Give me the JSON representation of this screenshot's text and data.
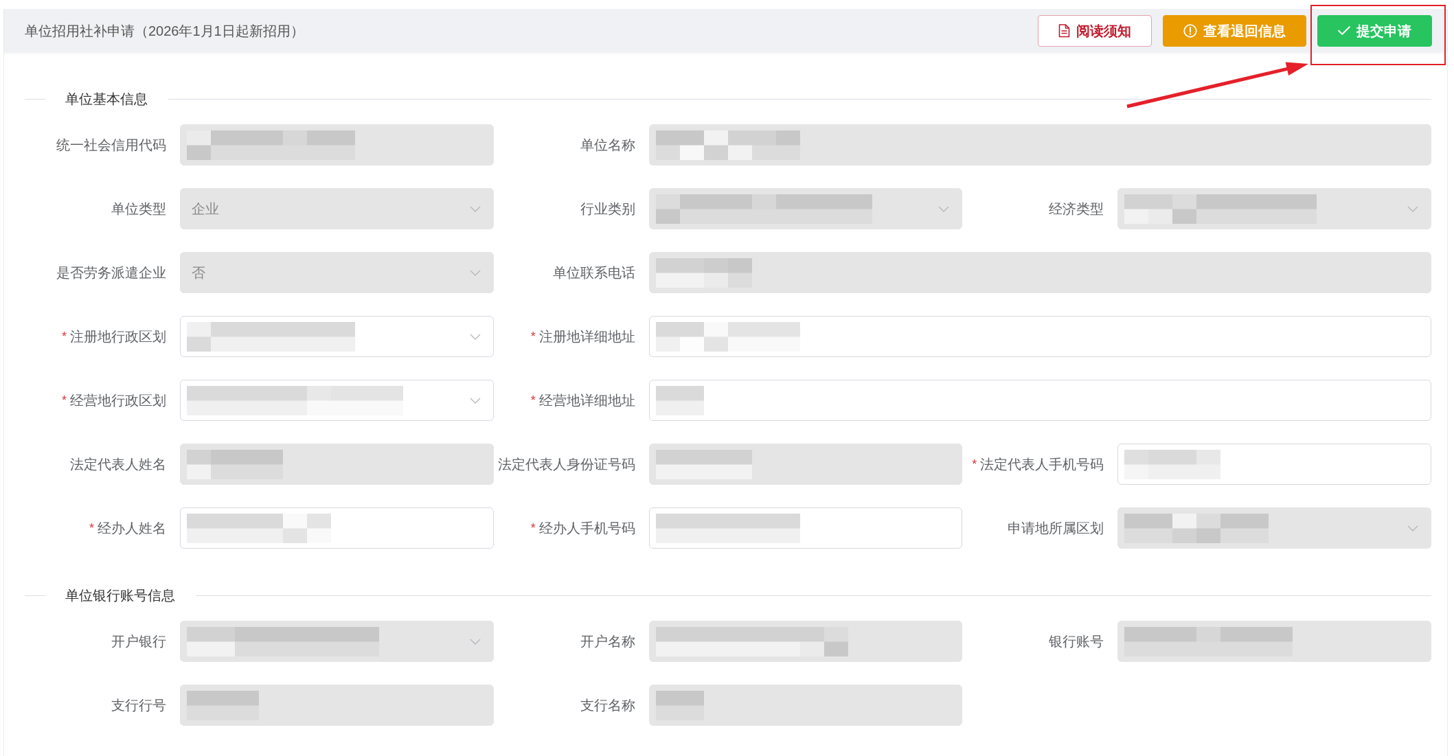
{
  "header": {
    "title": "单位招用社补申请（2026年1月1日起新招用）",
    "buttons": [
      {
        "kind": "notice",
        "label": "阅读须知",
        "highlighted": false
      },
      {
        "kind": "warning",
        "label": "查看退回信息",
        "highlighted": false
      },
      {
        "kind": "submit",
        "label": "提交申请",
        "highlighted": true
      }
    ]
  },
  "sections": [
    {
      "title": "单位基本信息",
      "rows": [
        [
          {
            "label": "统一社会信用代码",
            "kind": "input",
            "disabled": true,
            "redacted": true,
            "wide": false
          },
          {
            "label": "单位名称",
            "kind": "input",
            "disabled": true,
            "redacted": true,
            "wide": true
          }
        ],
        [
          {
            "label": "单位类型",
            "kind": "select",
            "disabled": true,
            "redacted": false,
            "value": "企业",
            "wide": false
          },
          {
            "label": "行业类别",
            "kind": "select",
            "disabled": true,
            "redacted": true,
            "wide": false
          },
          {
            "label": "经济类型",
            "kind": "select",
            "disabled": true,
            "redacted": true,
            "wide": false
          }
        ],
        [
          {
            "label": "是否劳务派遣企业",
            "kind": "select",
            "disabled": true,
            "redacted": false,
            "value": "否",
            "wide": false
          },
          {
            "label": "单位联系电话",
            "kind": "input",
            "disabled": true,
            "redacted": true,
            "wide": true
          }
        ],
        [
          {
            "label": "注册地行政区划",
            "required_mark": "*",
            "kind": "select",
            "disabled": false,
            "redacted": true,
            "wide": false
          },
          {
            "label": "注册地详细地址",
            "required_mark": "*",
            "kind": "input",
            "disabled": false,
            "redacted": true,
            "wide": true
          }
        ],
        [
          {
            "label": "经营地行政区划",
            "required_mark": "*",
            "kind": "select",
            "disabled": false,
            "redacted": true,
            "wide": false
          },
          {
            "label": "经营地详细地址",
            "required_mark": "*",
            "kind": "input",
            "disabled": false,
            "redacted": true,
            "wide": true
          }
        ],
        [
          {
            "label": "法定代表人姓名",
            "kind": "input",
            "disabled": true,
            "redacted": true,
            "wide": false
          },
          {
            "label": "法定代表人身份证号码",
            "kind": "input",
            "disabled": true,
            "redacted": true,
            "wide": false
          },
          {
            "label": "法定代表人手机号码",
            "required_mark": "*",
            "kind": "input",
            "disabled": false,
            "redacted": true,
            "wide": false
          }
        ],
        [
          {
            "label": "经办人姓名",
            "required_mark": "*",
            "kind": "input",
            "disabled": false,
            "redacted": true,
            "wide": false
          },
          {
            "label": "经办人手机号码",
            "required_mark": "*",
            "kind": "input",
            "disabled": false,
            "redacted": true,
            "wide": false
          },
          {
            "label": "申请地所属区划",
            "kind": "select",
            "disabled": true,
            "redacted": true,
            "wide": false
          }
        ]
      ]
    },
    {
      "title": "单位银行账号信息",
      "rows": [
        [
          {
            "label": "开户银行",
            "kind": "select",
            "disabled": true,
            "redacted": true,
            "wide": false
          },
          {
            "label": "开户名称",
            "kind": "input",
            "disabled": true,
            "redacted": true,
            "wide": false
          },
          {
            "label": "银行账号",
            "kind": "input",
            "disabled": true,
            "redacted": true,
            "wide": false
          }
        ],
        [
          {
            "label": "支行行号",
            "kind": "input",
            "disabled": true,
            "redacted": true,
            "wide": false
          },
          {
            "label": "支行名称",
            "kind": "input",
            "disabled": true,
            "redacted": true,
            "wide": false
          }
        ]
      ]
    }
  ]
}
